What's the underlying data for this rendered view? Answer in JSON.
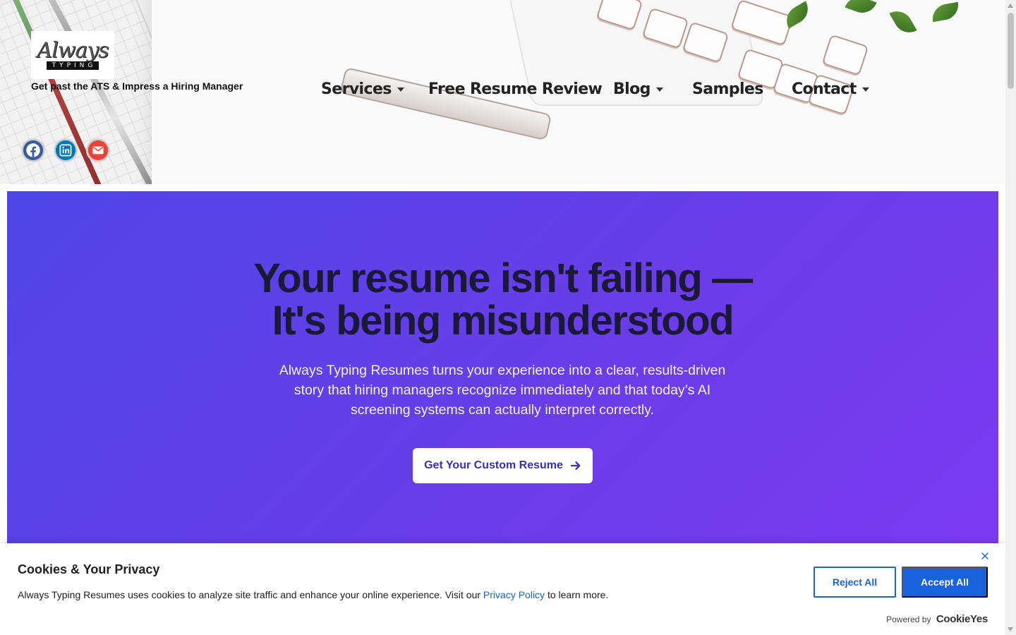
{
  "header": {
    "logo": {
      "script_text": "Always",
      "strip_text": "TYPING"
    },
    "tagline": "Get past the ATS & Impress a Hiring Manager",
    "social": [
      {
        "name": "facebook",
        "icon": "facebook-icon",
        "color": "#3b5998"
      },
      {
        "name": "linkedin",
        "icon": "linkedin-icon",
        "color": "#0077b5"
      },
      {
        "name": "email",
        "icon": "envelope-icon",
        "color": "#ea4335"
      }
    ],
    "nav": [
      {
        "label": "Services",
        "dropdown": true
      },
      {
        "label": "Free Resume Review",
        "dropdown": false
      },
      {
        "label": "Blog",
        "dropdown": true
      },
      {
        "label": "Samples",
        "dropdown": false
      },
      {
        "label": "Contact",
        "dropdown": true
      }
    ]
  },
  "hero": {
    "title_line1": "Your resume isn't failing —",
    "title_line2": "It's being misunderstood",
    "subtitle": "Always Typing Resumes turns your experience into a clear, results-driven story that hiring managers recognize immediately and that today’s AI screening systems can actually interpret correctly.",
    "cta_label": "Get Your Custom Resume",
    "colors": {
      "gradient_start": "#4f46e5",
      "gradient_end": "#7e3af2"
    }
  },
  "cookie_banner": {
    "title": "Cookies & Your Privacy",
    "text_before_link": "Always Typing Resumes uses cookies to analyze site traffic and enhance your online experience. Visit our ",
    "link_text": "Privacy Policy",
    "text_after_link": " to learn more.",
    "reject_label": "Reject All",
    "accept_label": "Accept All",
    "powered_by": "Powered by",
    "brand": "CookieYes",
    "accent_color": "#1863dc"
  }
}
